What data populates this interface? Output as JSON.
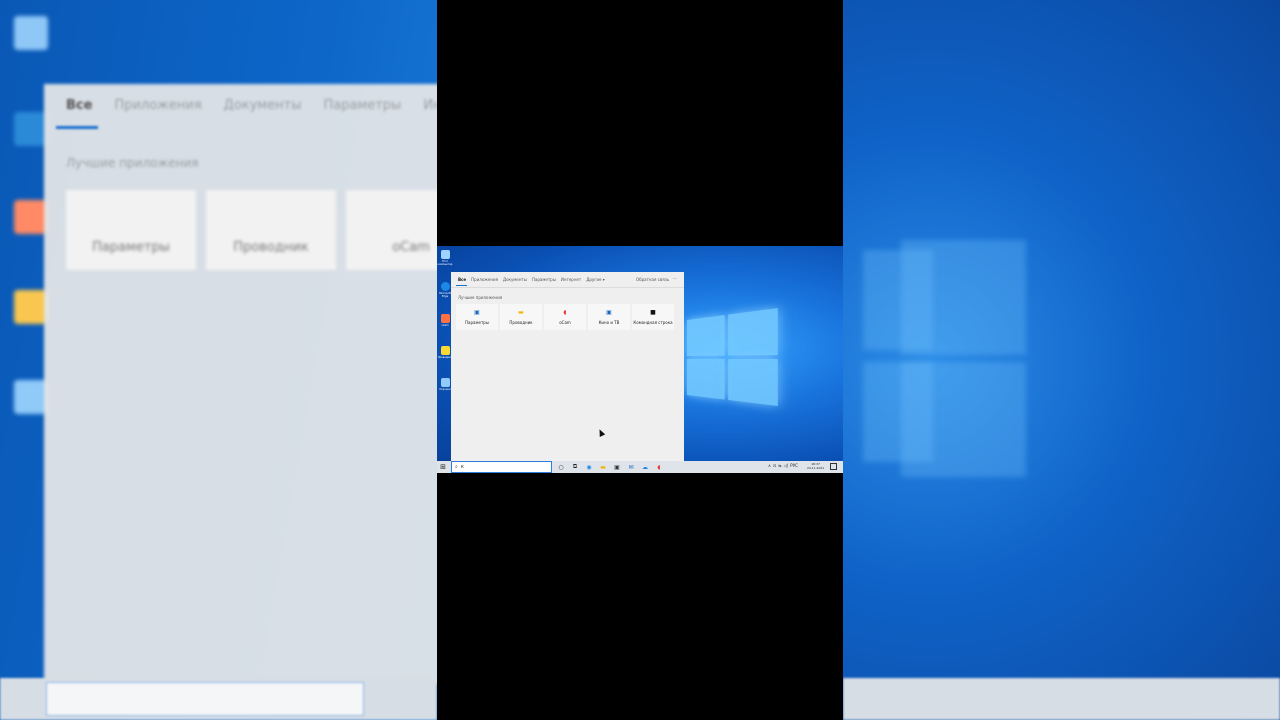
{
  "search_panel": {
    "tabs": [
      {
        "label": "Все",
        "active": true
      },
      {
        "label": "Приложения"
      },
      {
        "label": "Документы"
      },
      {
        "label": "Параметры"
      },
      {
        "label": "Интернет"
      },
      {
        "label": "Другие ▾"
      }
    ],
    "feedback_label": "Обратная связь",
    "more_label": "···",
    "section_title": "Лучшие приложения",
    "apps": [
      {
        "label": "Параметры",
        "icon": "settings-icon",
        "glyph": "▣",
        "color": "#1565c0"
      },
      {
        "label": "Проводник",
        "icon": "folder-icon",
        "glyph": "▬",
        "color": "#f4b400"
      },
      {
        "label": "oCam",
        "icon": "ocam-icon",
        "glyph": "◖",
        "color": "#e53935"
      },
      {
        "label": "Кино и ТВ",
        "icon": "movies-icon",
        "glyph": "▣",
        "color": "#1565c0"
      },
      {
        "label": "Командная строка",
        "icon": "cmd-icon",
        "glyph": "■",
        "color": "#111111"
      }
    ]
  },
  "desktop": {
    "icons": [
      {
        "label": "Этот компьютер",
        "color": "#9fd3ff"
      },
      {
        "label": "Microsoft Edge",
        "color": "#1e88e5"
      },
      {
        "label": "oCam",
        "color": "#ff7043"
      },
      {
        "label": "Проводник",
        "color": "#fdd835"
      },
      {
        "label": "Корзина",
        "color": "#90caf9"
      }
    ]
  },
  "taskbar": {
    "start_glyph": "⊞",
    "search_icon": "⌕",
    "search_value": "к",
    "apps": [
      {
        "icon": "cortana-icon",
        "glyph": "○",
        "color": "#222"
      },
      {
        "icon": "task-view-icon",
        "glyph": "⧉",
        "color": "#222"
      },
      {
        "icon": "edge-icon",
        "glyph": "◉",
        "color": "#1e88e5"
      },
      {
        "icon": "explorer-icon",
        "glyph": "▬",
        "color": "#f4b400"
      },
      {
        "icon": "store-icon",
        "glyph": "▣",
        "color": "#333"
      },
      {
        "icon": "mail-icon",
        "glyph": "✉",
        "color": "#1565c0"
      },
      {
        "icon": "weather-icon",
        "glyph": "☁",
        "color": "#1e88e5"
      },
      {
        "icon": "ocam-icon",
        "glyph": "◖",
        "color": "#e53935"
      }
    ],
    "tray": [
      "∧",
      "⊡",
      "⇆",
      "◁)",
      "РУС"
    ],
    "time": "18:37",
    "date": "24.11.2021"
  },
  "background_left": {
    "tabs": [
      "Все",
      "Приложения",
      "Документы",
      "Параметры",
      "Интерне"
    ],
    "section_title": "Лучшие приложения",
    "tiles": [
      "Параметры",
      "Проводник",
      "oCam"
    ]
  }
}
